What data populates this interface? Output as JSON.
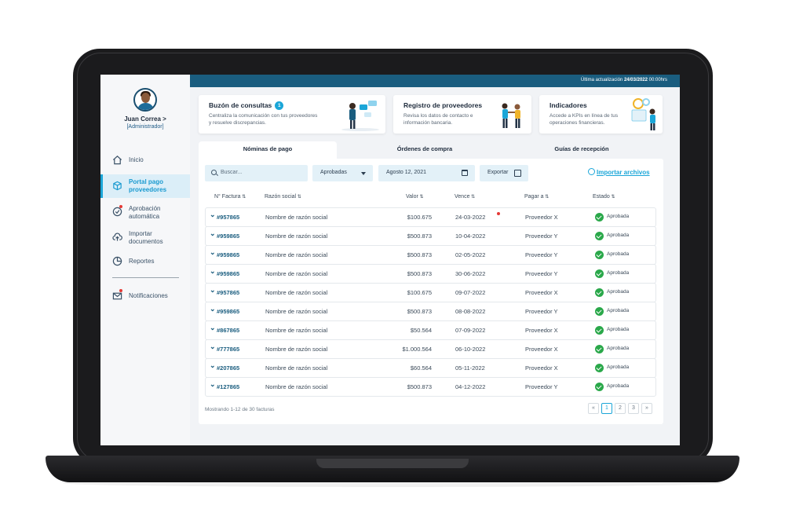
{
  "user": {
    "name": "Juan Correa >",
    "role": "[Administrador]"
  },
  "topbar": {
    "update_label": "Última actualización",
    "update_date": "24/03/2022",
    "update_time": "00:00hrs"
  },
  "sidebar": {
    "items": [
      {
        "label": "Inicio",
        "icon": "home-icon"
      },
      {
        "label": "Portal pago proveedores",
        "icon": "box-icon"
      },
      {
        "label": "Aprobación automática",
        "icon": "check-circle-icon"
      },
      {
        "label": "Importar documentos",
        "icon": "cloud-upload-icon"
      },
      {
        "label": "Reportes",
        "icon": "pie-chart-icon"
      },
      {
        "label": "Notificaciones",
        "icon": "mail-icon"
      }
    ]
  },
  "cards": [
    {
      "title": "Buzón de consultas",
      "badge": "1",
      "desc": "Centraliza la comunicación con tus proveedores y resuelve discrepancias."
    },
    {
      "title": "Registro de proveedores",
      "desc": "Revisa los datos de contacto e información bancaria."
    },
    {
      "title": "Indicadores",
      "desc": "Accede a KPIs en línea de tus operaciones financieras."
    }
  ],
  "tabs": [
    "Nóminas de pago",
    "Órdenes de compra",
    "Guías de recepción"
  ],
  "toolbar": {
    "search_placeholder": "Buscar...",
    "status_select": "Aprobadas",
    "date": "Agosto 12, 2021",
    "export_label": "Exportar",
    "import_label": "Importar archivos"
  },
  "table": {
    "headers": [
      "N° Factura",
      "Razón social",
      "Valor",
      "Vence",
      "Pagar a",
      "Estado"
    ],
    "rows": [
      {
        "invoice": "#957865",
        "name": "Nombre de razón social",
        "value": "$100.675",
        "due": "24-03-2022",
        "pay_to": "Proveedor X",
        "status": "Aprobada"
      },
      {
        "invoice": "#959865",
        "name": "Nombre de razón social",
        "value": "$500.873",
        "due": "10-04-2022",
        "pay_to": "Proveedor Y",
        "status": "Aprobada"
      },
      {
        "invoice": "#959865",
        "name": "Nombre de razón social",
        "value": "$500.873",
        "due": "02-05-2022",
        "pay_to": "Proveedor Y",
        "status": "Aprobada"
      },
      {
        "invoice": "#959865",
        "name": "Nombre de razón social",
        "value": "$500.873",
        "due": "30-06-2022",
        "pay_to": "Proveedor Y",
        "status": "Aprobada"
      },
      {
        "invoice": "#957865",
        "name": "Nombre de razón social",
        "value": "$100.675",
        "due": "09-07-2022",
        "pay_to": "Proveedor X",
        "status": "Aprobada"
      },
      {
        "invoice": "#959865",
        "name": "Nombre de razón social",
        "value": "$500.873",
        "due": "08-08-2022",
        "pay_to": "Proveedor Y",
        "status": "Aprobada"
      },
      {
        "invoice": "#867865",
        "name": "Nombre de razón social",
        "value": "$50.564",
        "due": "07-09-2022",
        "pay_to": "Proveedor X",
        "status": "Aprobada"
      },
      {
        "invoice": "#777865",
        "name": "Nombre de razón social",
        "value": "$1.000.564",
        "due": "06-10-2022",
        "pay_to": "Proveedor X",
        "status": "Aprobada"
      },
      {
        "invoice": "#207865",
        "name": "Nombre de razón social",
        "value": "$60.564",
        "due": "05-11-2022",
        "pay_to": "Proveedor X",
        "status": "Aprobada"
      },
      {
        "invoice": "#127865",
        "name": "Nombre de razón social",
        "value": "$500.873",
        "due": "04-12-2022",
        "pay_to": "Proveedor Y",
        "status": "Aprobada"
      }
    ]
  },
  "footer": {
    "showing": "Mostrando 1-12 de 30 facturas"
  },
  "pagination": {
    "prev": "«",
    "pages": [
      "1",
      "2",
      "3"
    ],
    "next": "»",
    "current": "1"
  },
  "colors": {
    "accent": "#1ba6d8",
    "topbar": "#1a5d7f",
    "success": "#2aa84a",
    "alert": "#e53935"
  }
}
